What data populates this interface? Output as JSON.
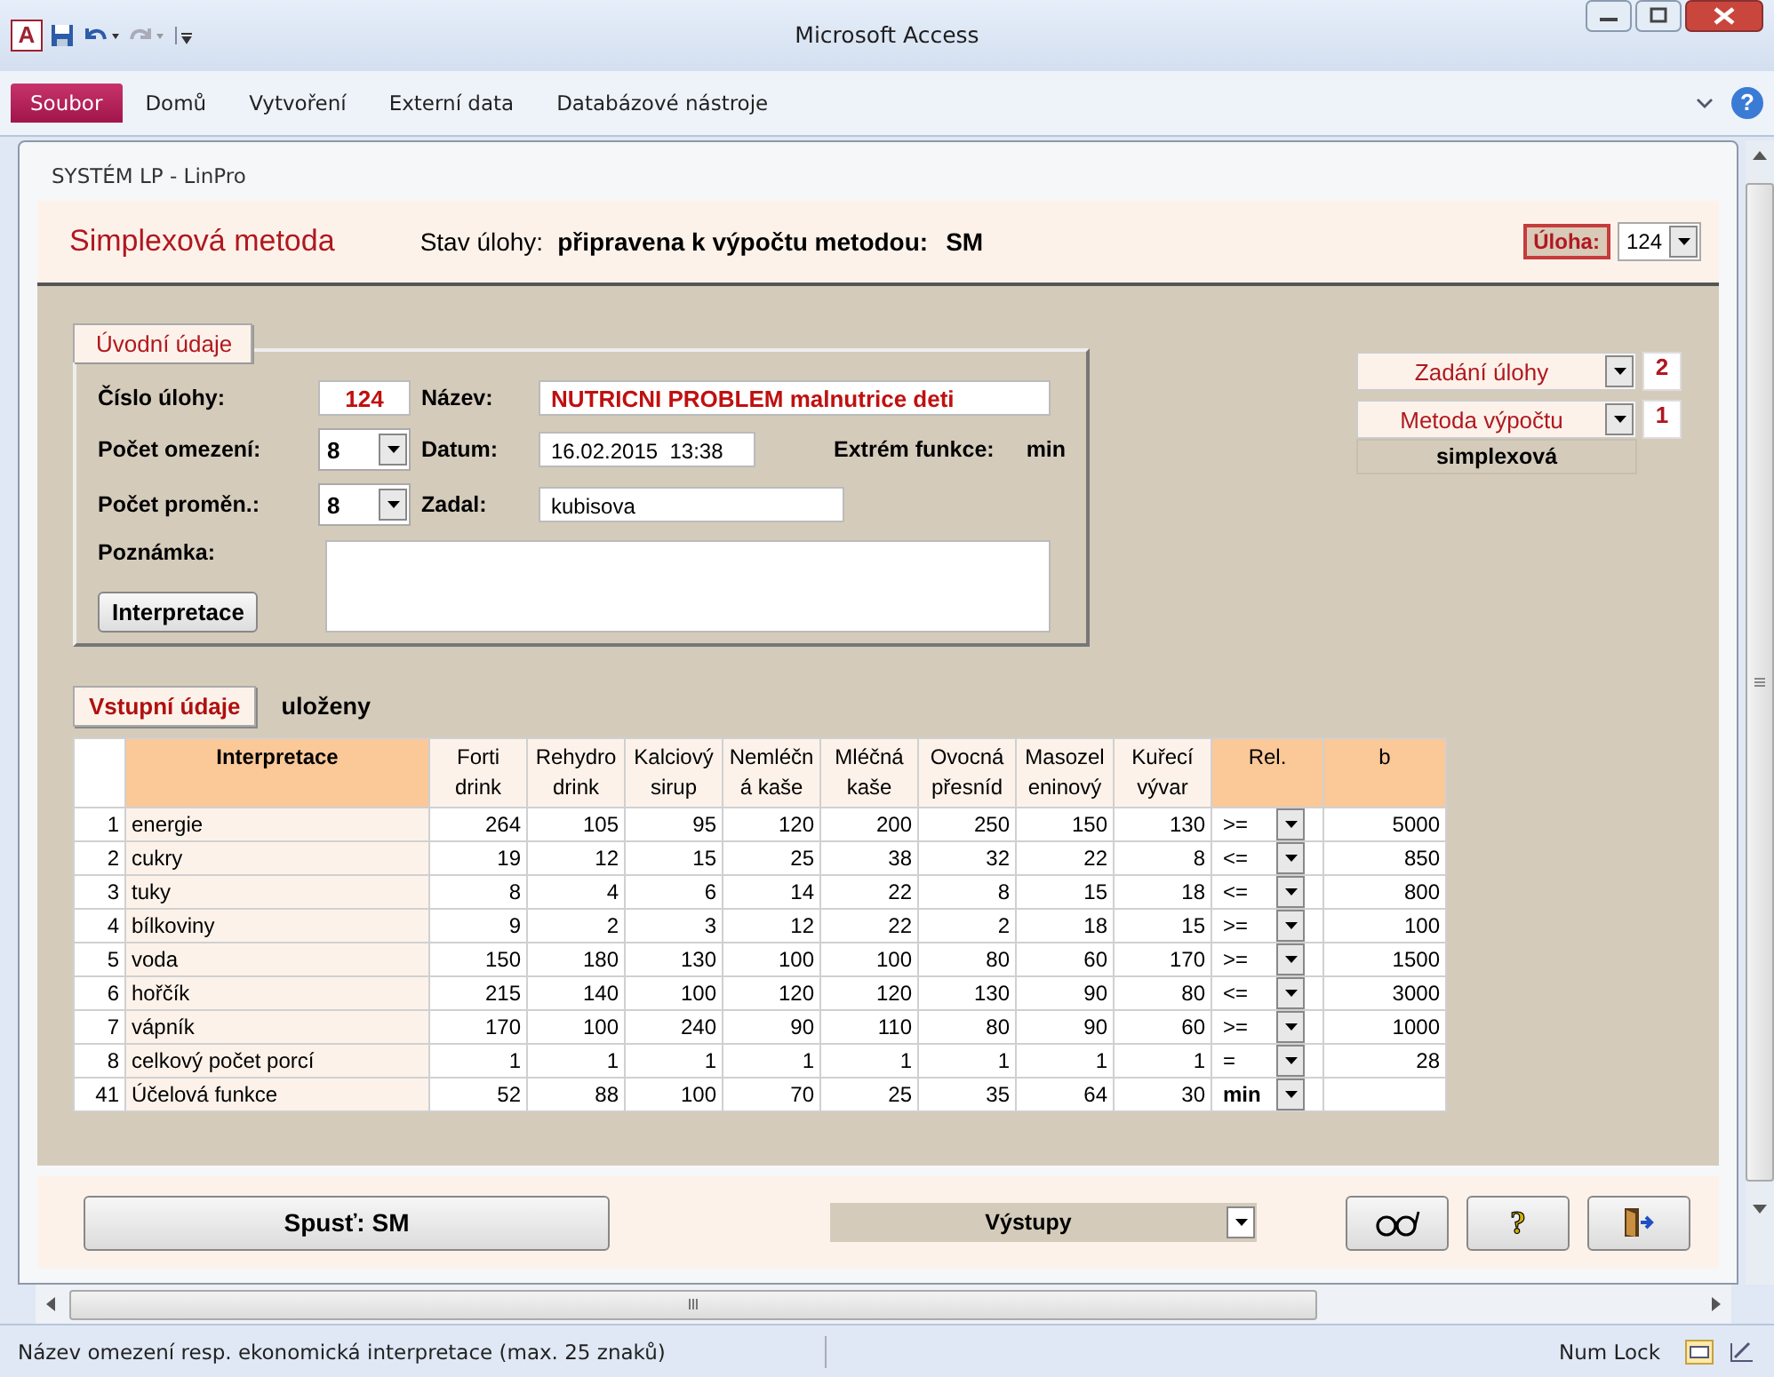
{
  "window": {
    "title": "Microsoft Access",
    "app_icon": "A"
  },
  "ribbon": {
    "tabs": [
      {
        "label": "Soubor",
        "selected": true
      },
      {
        "label": "Domů",
        "selected": false
      },
      {
        "label": "Vytvoření",
        "selected": false
      },
      {
        "label": "Externí data",
        "selected": false
      },
      {
        "label": "Databázové nástroje",
        "selected": false
      }
    ],
    "help": "?"
  },
  "form": {
    "caption": "SYSTÉM LP - LinPro",
    "header": {
      "title": "Simplexová metoda",
      "status_label": "Stav úlohy:",
      "status": "připravena k výpočtu metodou:",
      "method": "SM",
      "task_label": "Úloha:",
      "task_value": "124"
    },
    "intro": {
      "tab": "Úvodní údaje",
      "task_no_label": "Číslo úlohy:",
      "task_no": "124",
      "name_label": "Název:",
      "name": "NUTRICNI PROBLEM malnutrice deti",
      "constraints_label": "Počet omezení:",
      "constraints": "8",
      "date_label": "Datum:",
      "date": "16.02.2015  13:38",
      "extreme_label": "Extrém funkce:",
      "extreme": "min",
      "variables_label": "Počet proměn.:",
      "variables": "8",
      "author_label": "Zadal:",
      "author": "kubisova",
      "note_label": "Poznámka:",
      "interp_button": "Interpretace"
    },
    "side": {
      "items": [
        {
          "label": "Zadání úlohy",
          "count": "2"
        },
        {
          "label": "Metoda výpočtu",
          "count": "1"
        }
      ],
      "method_name": "simplexová"
    },
    "input": {
      "button": "Vstupní údaje",
      "status": "uloženy",
      "table": {
        "columns": [
          "Interpretace",
          "Forti\ndrink",
          "Rehydro\ndrink",
          "Kalciový\nsirup",
          "Nemléčn\ná kaše",
          "Mléčná\nkaše",
          "Ovocná\npřesníd",
          "Masozel\neninový",
          "Kuřecí\nvývar",
          "Rel.",
          "b"
        ],
        "rows": [
          {
            "no": "1",
            "name": "energie",
            "values": [
              "264",
              "105",
              "95",
              "120",
              "200",
              "250",
              "150",
              "130"
            ],
            "rel": ">=",
            "b": "5000"
          },
          {
            "no": "2",
            "name": "cukry",
            "values": [
              "19",
              "12",
              "15",
              "25",
              "38",
              "32",
              "22",
              "8"
            ],
            "rel": "<=",
            "b": "850"
          },
          {
            "no": "3",
            "name": "tuky",
            "values": [
              "8",
              "4",
              "6",
              "14",
              "22",
              "8",
              "15",
              "18"
            ],
            "rel": "<=",
            "b": "800"
          },
          {
            "no": "4",
            "name": "bílkoviny",
            "values": [
              "9",
              "2",
              "3",
              "12",
              "22",
              "2",
              "18",
              "15"
            ],
            "rel": ">=",
            "b": "100"
          },
          {
            "no": "5",
            "name": "voda",
            "values": [
              "150",
              "180",
              "130",
              "100",
              "100",
              "80",
              "60",
              "170"
            ],
            "rel": ">=",
            "b": "1500"
          },
          {
            "no": "6",
            "name": "hořčík",
            "values": [
              "215",
              "140",
              "100",
              "120",
              "120",
              "130",
              "90",
              "80"
            ],
            "rel": "<=",
            "b": "3000"
          },
          {
            "no": "7",
            "name": "vápník",
            "values": [
              "170",
              "100",
              "240",
              "90",
              "110",
              "80",
              "90",
              "60"
            ],
            "rel": ">=",
            "b": "1000"
          },
          {
            "no": "8",
            "name": "celkový počet porcí",
            "values": [
              "1",
              "1",
              "1",
              "1",
              "1",
              "1",
              "1",
              "1"
            ],
            "rel": "=",
            "b": "28"
          },
          {
            "no": "41",
            "name": "Účelová funkce",
            "values": [
              "52",
              "88",
              "100",
              "70",
              "25",
              "35",
              "64",
              "30"
            ],
            "rel": "min"
          }
        ]
      }
    },
    "footer": {
      "run_button": "Spusť: SM",
      "outputs": "Výstupy",
      "tools": [
        {
          "kind": "glasses"
        },
        {
          "kind": "help",
          "text": "?"
        },
        {
          "kind": "exit"
        }
      ]
    }
  },
  "status_bar": {
    "text": "Název omezení resp. ekonomická interpretace (max. 25 znaků)",
    "num_lock": "Num Lock"
  }
}
